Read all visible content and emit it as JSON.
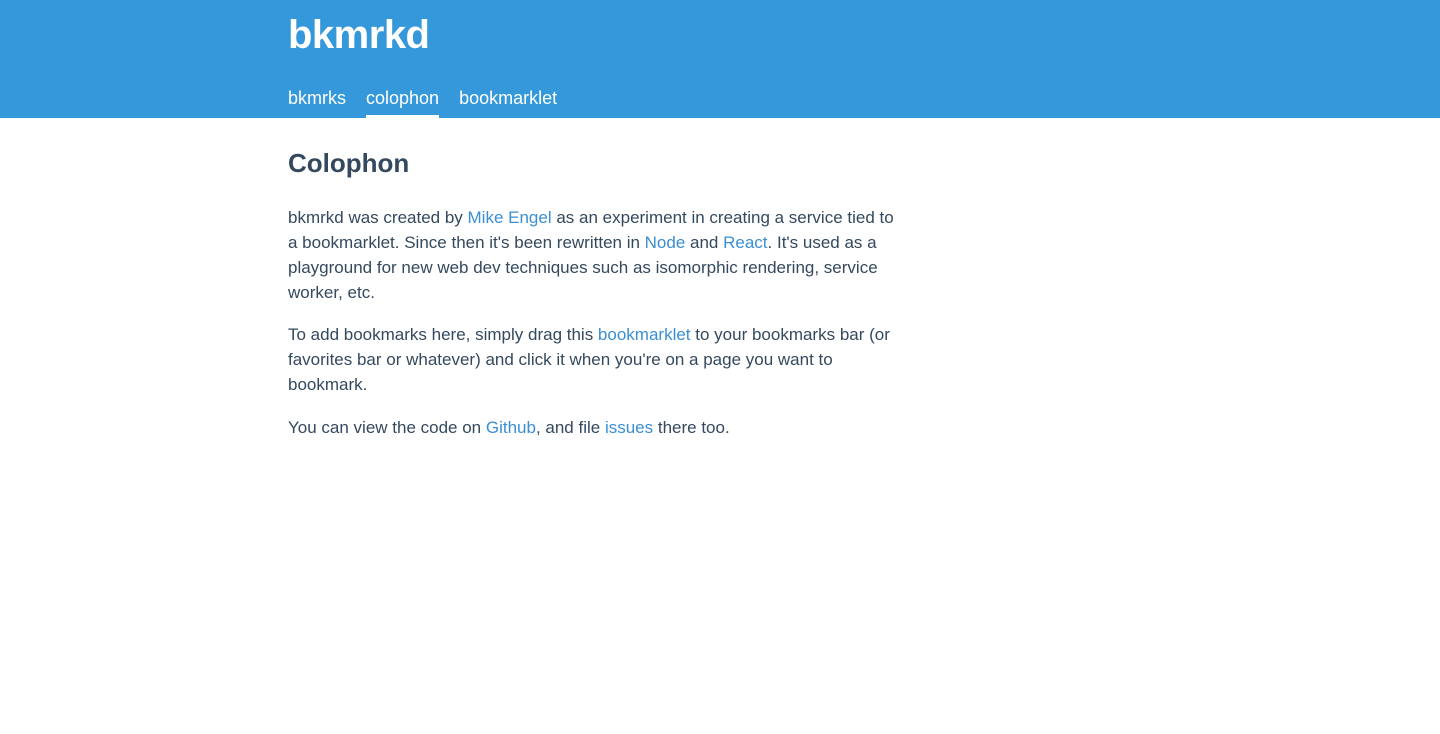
{
  "header": {
    "brand": "bkmrkd",
    "nav": [
      {
        "label": "bkmrks",
        "active": false
      },
      {
        "label": "colophon",
        "active": true
      },
      {
        "label": "bookmarklet",
        "active": false
      }
    ]
  },
  "main": {
    "title": "Colophon",
    "p1": {
      "t1": "bkmrkd was created by ",
      "link_author": "Mike Engel",
      "t2": " as an experiment in creating a service tied to a bookmarklet. Since then it's been rewritten in ",
      "link_node": "Node",
      "t3": " and ",
      "link_react": "React",
      "t4": ". It's used as a playground for new web dev techniques such as isomorphic rendering, service worker, etc."
    },
    "p2": {
      "t1": "To add bookmarks here, simply drag this ",
      "link_bookmarklet": "bookmarklet",
      "t2": " to your bookmarks bar (or favorites bar or whatever) and click it when you're on a page you want to bookmark."
    },
    "p3": {
      "t1": "You can view the code on ",
      "link_github": "Github",
      "t2": ", and file ",
      "link_issues": "issues",
      "t3": " there too."
    }
  },
  "colors": {
    "header_bg": "#3498db",
    "text": "#34495e",
    "link": "#3a8fd4"
  }
}
